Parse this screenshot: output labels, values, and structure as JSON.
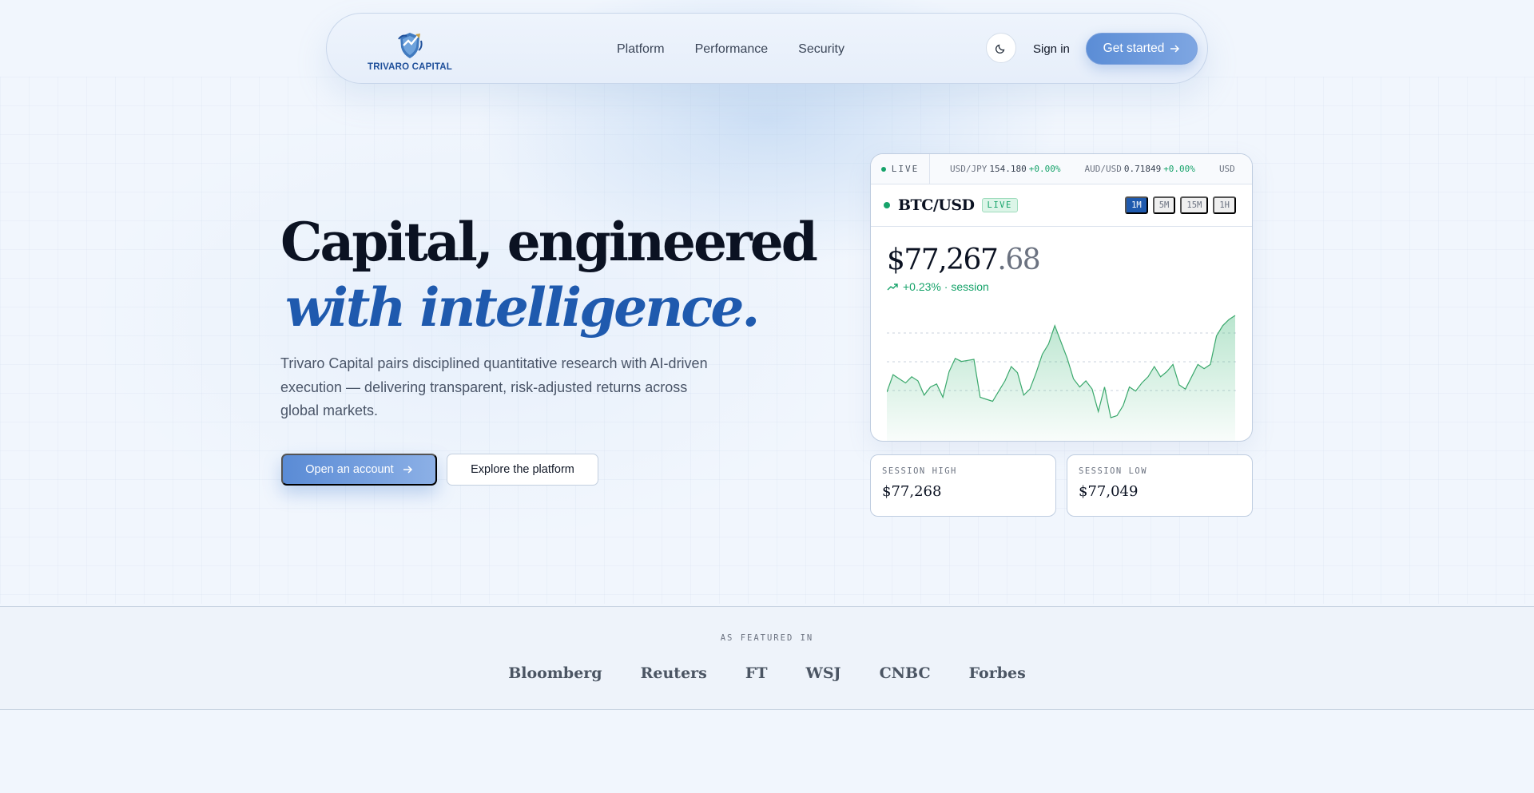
{
  "brand": {
    "name": "TRIVARO CAPITAL",
    "colors": {
      "primary": "#1f5aae",
      "accent": "#5b8dd6",
      "positive": "#16a36a",
      "text": "#0b1222"
    }
  },
  "nav": {
    "links": [
      "Platform",
      "Performance",
      "Security"
    ],
    "theme_icon": "moon-icon",
    "signin_label": "Sign in",
    "cta_label": "Get started"
  },
  "hero": {
    "title_line1": "Capital, engineered",
    "title_line2": "with intelligence.",
    "description": "Trivaro Capital pairs disciplined quantitative research with AI-driven execution — delivering transparent, risk-adjusted returns across global markets.",
    "primary_cta": "Open an account",
    "secondary_cta": "Explore the platform"
  },
  "market_card": {
    "ticker_live_label": "LIVE",
    "ticker": [
      {
        "pair": "USD/JPY",
        "value": "154.180",
        "change": "+0.00%"
      },
      {
        "pair": "AUD/USD",
        "value": "0.71849",
        "change": "+0.00%"
      },
      {
        "pair": "USD",
        "value": "",
        "change": ""
      }
    ],
    "pair": "BTC/USD",
    "pair_badge": "LIVE",
    "timeframes": [
      "1M",
      "5M",
      "15M",
      "1H"
    ],
    "active_timeframe": "1M",
    "price_main": "$77,267",
    "price_cents": ".68",
    "change_text": "+0.23% · session",
    "sparkline": [
      0.25,
      0.42,
      0.38,
      0.34,
      0.4,
      0.36,
      0.22,
      0.3,
      0.33,
      0.2,
      0.45,
      0.58,
      0.55,
      0.56,
      0.57,
      0.2,
      0.18,
      0.16,
      0.26,
      0.36,
      0.5,
      0.44,
      0.22,
      0.28,
      0.44,
      0.62,
      0.72,
      0.9,
      0.74,
      0.58,
      0.38,
      0.3,
      0.36,
      0.28,
      0.06,
      0.3,
      0.0,
      0.02,
      0.12,
      0.3,
      0.26,
      0.34,
      0.4,
      0.5,
      0.4,
      0.45,
      0.52,
      0.32,
      0.28,
      0.4,
      0.52,
      0.48,
      0.52,
      0.8,
      0.9,
      0.96,
      1.0
    ]
  },
  "stats": [
    {
      "label": "SESSION HIGH",
      "value": "$77,268"
    },
    {
      "label": "SESSION LOW",
      "value": "$77,049"
    }
  ],
  "featured": {
    "label": "AS FEATURED IN",
    "outlets": [
      "Bloomberg",
      "Reuters",
      "FT",
      "WSJ",
      "CNBC",
      "Forbes"
    ]
  }
}
